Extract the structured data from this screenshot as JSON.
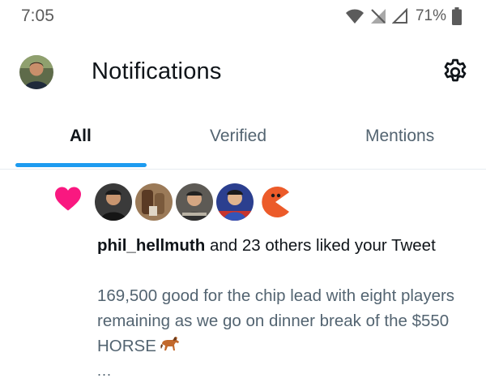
{
  "status_bar": {
    "time": "7:05",
    "battery_percent": "71%",
    "icons": [
      "wifi-icon",
      "no-signal-icon",
      "cell-signal-icon",
      "battery-icon"
    ]
  },
  "header": {
    "title": "Notifications",
    "settings_icon": "gear-icon"
  },
  "tabs": {
    "items": [
      {
        "label": "All",
        "active": true
      },
      {
        "label": "Verified",
        "active": false
      },
      {
        "label": "Mentions",
        "active": false
      }
    ],
    "accent": "#1d9bf0"
  },
  "notification": {
    "type_icon": "heart-icon",
    "type_color": "#f91880",
    "liker_avatars_count": 5,
    "username": "phil_hellmuth",
    "action_text": " and 23 others liked your Tweet",
    "tweet_text": "169,500 good for the chip lead with eight players remaining as we go on dinner break of the $550 HORSE",
    "tweet_emoji": "horse-icon",
    "more_indicator": "..."
  }
}
